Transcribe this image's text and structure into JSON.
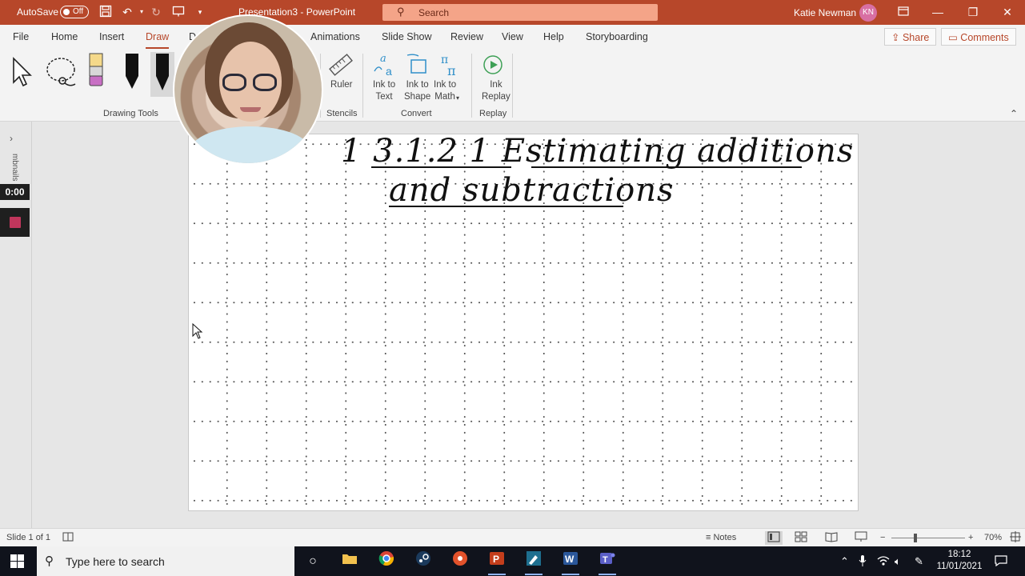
{
  "titlebar": {
    "autosave_label": "AutoSave",
    "autosave_state": "Off",
    "doc_title": "Presentation3 - PowerPoint",
    "search_placeholder": "Search",
    "user_name": "Katie Newman",
    "user_initials": "KN"
  },
  "tabs": {
    "file": "File",
    "home": "Home",
    "insert": "Insert",
    "draw": "Draw",
    "design": "D",
    "animations": "Animations",
    "slide_show": "Slide Show",
    "review": "Review",
    "view": "View",
    "help": "Help",
    "storyboarding": "Storyboarding",
    "share": "Share",
    "comments": "Comments"
  },
  "ribbon": {
    "drawing_tools_label": "Drawing Tools",
    "stencils_label": "Stencils",
    "convert_label": "Convert",
    "replay_label": "Replay",
    "ruler": "Ruler",
    "ink_to_text": "Ink to\nText",
    "ink_to_shape": "Ink to\nShape",
    "ink_to_math": "Ink to\nMath",
    "ink_replay": "Ink\nReplay"
  },
  "leftstrip": {
    "thumbnails_label": "mbnails",
    "timer": "0:00"
  },
  "slide": {
    "title_line1": "1 3.1.2 1 Estimating additions",
    "title_line2": "and subtractions"
  },
  "statusbar": {
    "slide_count": "Slide 1 of 1",
    "notes": "Notes",
    "zoom": "70%"
  },
  "taskbar": {
    "search_placeholder": "Type here to search",
    "time": "18:12",
    "date": "11/01/2021"
  },
  "colors": {
    "accent": "#b7472a",
    "search_bg": "#f4a488",
    "taskbar": "#10131c"
  }
}
